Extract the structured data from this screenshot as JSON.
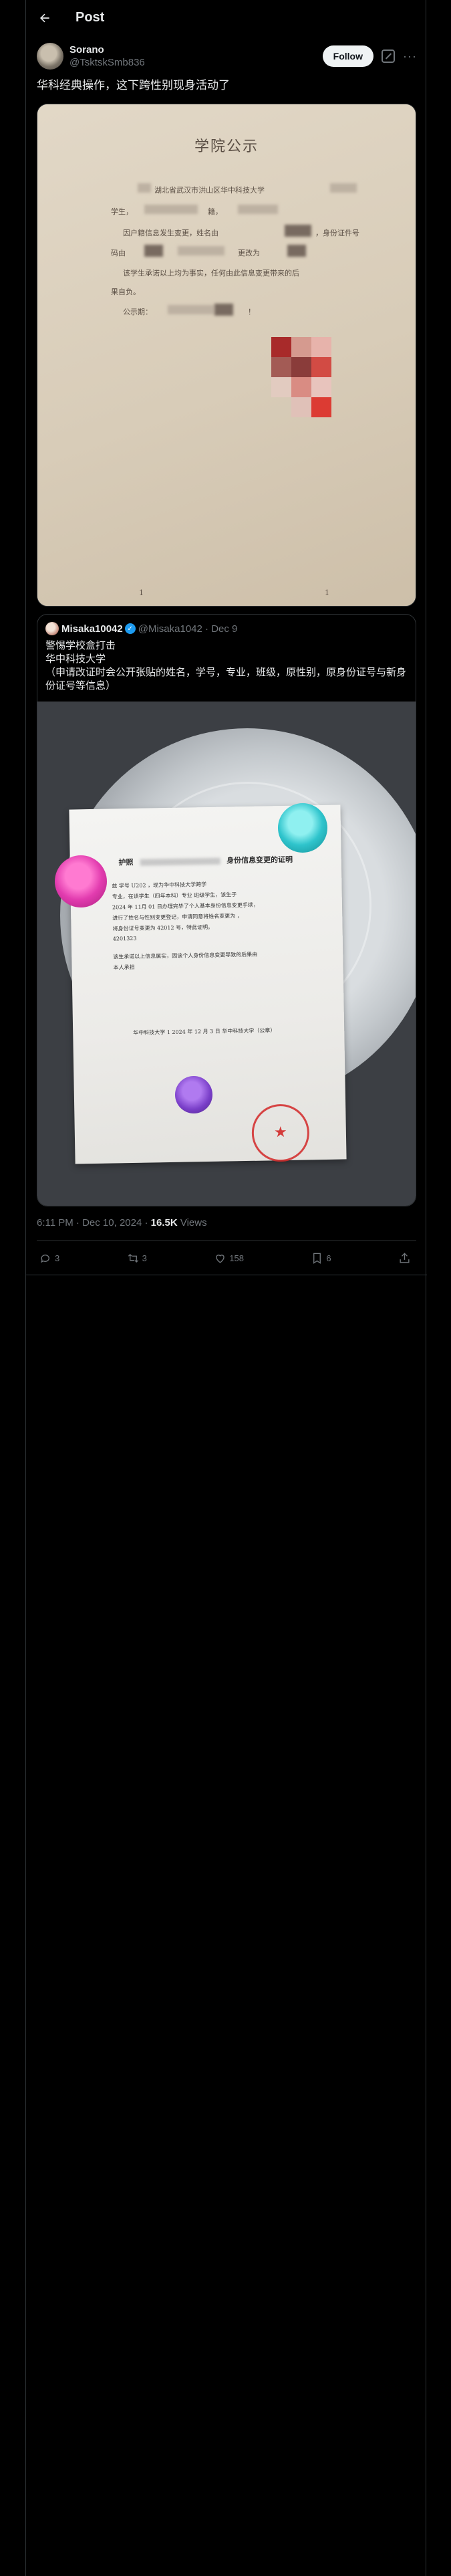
{
  "header": {
    "title": "Post"
  },
  "post": {
    "display_name": "Sorano",
    "handle": "@TsktskSmb836",
    "follow_label": "Follow",
    "more_glyph": "···",
    "text": "华科经典操作，这下跨性别现身活动了",
    "timestamp": "6:11 PM · Dec 10, 2024 · ",
    "views_count": "16.5K",
    "views_label": " Views",
    "replies": "3",
    "reposts": "3",
    "likes": "158",
    "bookmarks": "6"
  },
  "media1": {
    "title": "学院公示",
    "line1": "湖北省武汉市洪山区华中科技大学",
    "line2_a": "学生，",
    "line2_b": "籍，",
    "line3_a": "因户籍信息发生变更，姓名由",
    "line3_b": "，身份证件号",
    "line4_a": "码由",
    "line4_b": "更改为",
    "line5": "该学生承诺以上均为事实，任何由此信息变更带来的后",
    "line6": "果自负。",
    "line7_a": "公示期：",
    "line7_b": "！",
    "footer_a": "1",
    "footer_b": "1"
  },
  "quote": {
    "display_name": "Misaka10042",
    "handle": "@Misaka1042 · Dec 9",
    "line1": "警惕学校盒打击",
    "line2": "华中科技大学",
    "line3": "（申请改证时会公开张贴的姓名，学号，专业，班级，原性别，原身份证号与新身份证号等信息）",
    "doc_title_prefix": "护照",
    "doc_title": "身份信息变更的证明",
    "doc_lines": [
      "兹  学号 U202   ，现为华中科技大学跨学",
      "专业，在读学生（四年本科）专业 班级学生，该生于",
      "2024 年 11月 01 日办理完毕了个人基本身份信息变更手续，",
      "进行了姓名与性别变更登记，申请同意将姓名变更为 ，",
      "将身份证号变更为 42012      号，特此证明。",
      "4201323",
      "该生承诺以上信息属实，因该个人身份信息变更导致的后果由",
      "本人承担",
      "华中科技大学 1 2024 年 12 月 3 日   华中科技大学（公章）"
    ]
  },
  "colors": {
    "background": "#000000",
    "text_primary": "#e7e9ea",
    "text_secondary": "#71767b",
    "border": "#2f3336",
    "verified": "#1d9bf0"
  },
  "icons": [
    "back-arrow-icon",
    "grok-icon",
    "more-icon",
    "verified-icon",
    "reply-icon",
    "repost-icon",
    "like-icon",
    "bookmark-icon",
    "share-icon"
  ]
}
